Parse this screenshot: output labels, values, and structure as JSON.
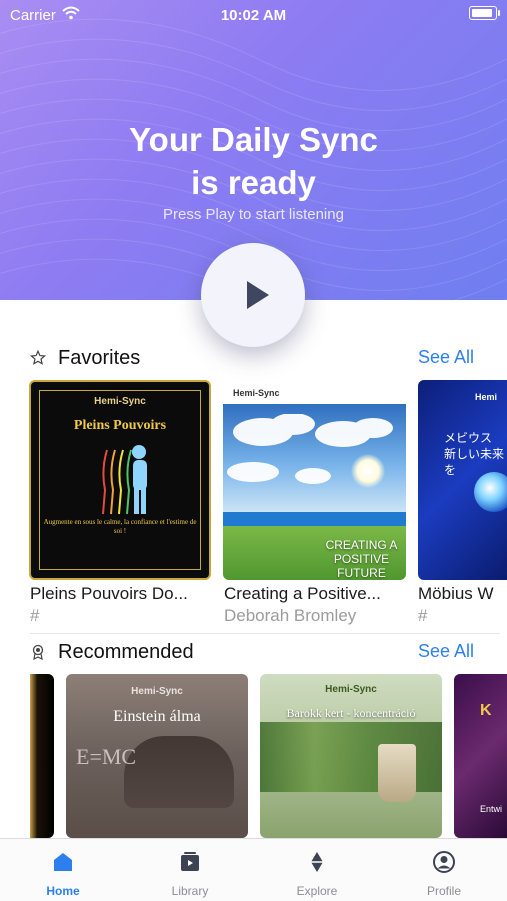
{
  "status_bar": {
    "carrier": "Carrier",
    "time": "10:02 AM",
    "battery_level": 0.9
  },
  "hero": {
    "title_line1": "Your Daily Sync",
    "title_line2": "is ready",
    "subtitle": "Press Play to start listening",
    "play_icon": "play-icon",
    "colors": {
      "gradient_start": "#a98df2",
      "gradient_end": "#6f7ef0"
    }
  },
  "favorites": {
    "title": "Favorites",
    "icon": "star-icon",
    "see_all": "See All",
    "items": [
      {
        "title": "Pleins Pouvoirs Do...",
        "subtitle": "#",
        "cover_brand": "Hemi-Sync",
        "cover_title": "Pleins Pouvoirs",
        "cover_text": "Augmente en sous le calme, la confiance et l'estime de soi !"
      },
      {
        "title": "Creating a Positive...",
        "subtitle": "Deborah Bromley",
        "cover_brand": "Hemi-Sync",
        "cover_text": "CREATING A POSITIVE FUTURE"
      },
      {
        "title": "Möbius W",
        "subtitle": "#",
        "cover_brand": "Hemi",
        "cover_text": "メビウス 新しい未来を"
      }
    ]
  },
  "recommended": {
    "title": "Recommended",
    "icon": "award-icon",
    "see_all": "See All",
    "items": [
      {
        "cover_title": ""
      },
      {
        "cover_brand": "Hemi-Sync",
        "cover_title": "Einstein álma",
        "cover_text": "E=MC"
      },
      {
        "cover_brand": "Hemi-Sync",
        "cover_title": "Barokk kert - koncentráció"
      },
      {
        "cover_title": "K",
        "cover_text": "Entwi"
      }
    ]
  },
  "tabs": [
    {
      "label": "Home",
      "icon": "home-icon",
      "active": true
    },
    {
      "label": "Library",
      "icon": "library-icon",
      "active": false
    },
    {
      "label": "Explore",
      "icon": "explore-icon",
      "active": false
    },
    {
      "label": "Profile",
      "icon": "profile-icon",
      "active": false
    }
  ],
  "colors": {
    "accent": "#2d7ff0",
    "tab_inactive": "#8e8e93"
  }
}
